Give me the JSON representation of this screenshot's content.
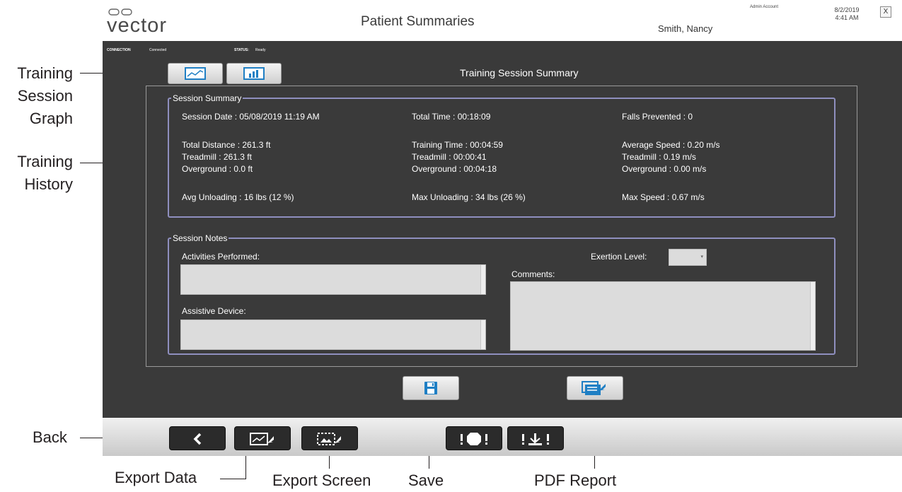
{
  "callouts": {
    "training_session_graph": "Training\nSession\nGraph",
    "training_history": "Training\nHistory",
    "back": "Back",
    "export_data": "Export Data",
    "export_screen": "Export Screen",
    "save": "Save",
    "pdf_report": "PDF Report"
  },
  "window": {
    "logo": "vector",
    "title": "Patient Summaries",
    "patient_name": "Smith, Nancy",
    "account": "Admin Account",
    "date": "8/2/2019",
    "time": "4:41 AM",
    "close_label": "X"
  },
  "status": {
    "connection_label": "CONNECTION",
    "connection_value": "Connected",
    "status_label": "STATUS:",
    "status_value": "Ready"
  },
  "section_title": "Training Session Summary",
  "session_summary": {
    "label": "Session Summary",
    "session_date": "Session Date : 05/08/2019 11:19 AM",
    "total_time": "Total Time : 00:18:09",
    "falls_prevented": "Falls Prevented : 0",
    "total_distance": "Total Distance : 261.3  ft",
    "treadmill_distance": "Treadmill : 261.3  ft",
    "overground_distance": "Overground : 0.0  ft",
    "training_time": "Training Time : 00:04:59",
    "treadmill_time": "Treadmill : 00:00:41",
    "overground_time": "Overground : 00:04:18",
    "average_speed": "Average Speed : 0.20 m/s",
    "treadmill_speed": "Treadmill : 0.19 m/s",
    "overground_speed": "Overground : 0.00 m/s",
    "avg_unloading": "Avg Unloading : 16  lbs (12 %)",
    "max_unloading": "Max Unloading : 34  lbs (26 %)",
    "max_speed": "Max Speed : 0.67 m/s"
  },
  "session_notes": {
    "label": "Session Notes",
    "activities_label": "Activities Performed:",
    "activities_value": "",
    "assistive_label": "Assistive Device:",
    "assistive_value": "",
    "exertion_label": "Exertion Level:",
    "exertion_value": "",
    "comments_label": "Comments:",
    "comments_value": ""
  },
  "icons": {
    "training_session_graph": "line-graph-icon",
    "training_history": "bar-chart-icon",
    "save": "floppy-disk-icon",
    "pdf_report": "pdf-report-icon",
    "back": "chevron-left-icon",
    "export_data": "export-data-icon",
    "export_screen": "export-screen-icon",
    "stop": "emergency-stop-icon",
    "unload": "unload-icon"
  },
  "colors": {
    "background_dark": "#3a3a3a",
    "group_border": "#8f8fbf",
    "icon_blue": "#1f7fc4"
  }
}
